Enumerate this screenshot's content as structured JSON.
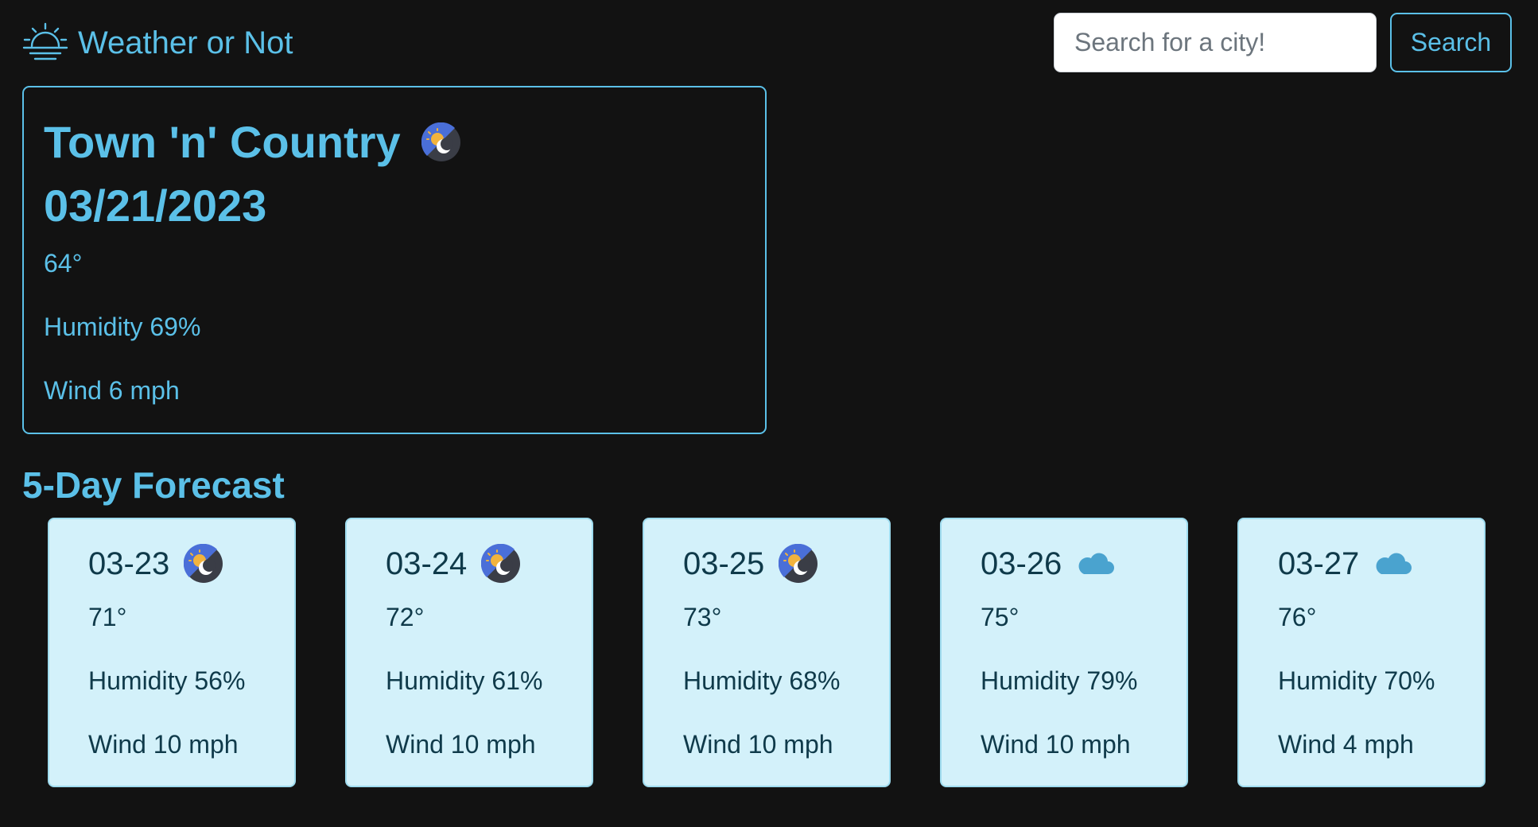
{
  "app": {
    "title": "Weather or Not",
    "accent_color": "#5bc0e8",
    "background_color": "#121212",
    "brand_icon": "sunrise-icon"
  },
  "search": {
    "placeholder": "Search for a city!",
    "value": "",
    "button_label": "Search"
  },
  "current": {
    "city": "Town 'n' Country",
    "date": "03/21/2023",
    "icon": "partly-cloudy-night-icon",
    "temp": "64°",
    "humidity": "Humidity 69%",
    "wind": "Wind 6 mph"
  },
  "forecast": {
    "heading": "5-Day Forecast",
    "card_color": "#d3f1fa",
    "days": [
      {
        "date": "03-23",
        "icon": "partly-cloudy-night-icon",
        "temp": "71°",
        "humidity": "Humidity 56%",
        "wind": "Wind 10 mph"
      },
      {
        "date": "03-24",
        "icon": "partly-cloudy-night-icon",
        "temp": "72°",
        "humidity": "Humidity 61%",
        "wind": "Wind 10 mph"
      },
      {
        "date": "03-25",
        "icon": "partly-cloudy-night-icon",
        "temp": "73°",
        "humidity": "Humidity 68%",
        "wind": "Wind 10 mph"
      },
      {
        "date": "03-26",
        "icon": "cloud-icon",
        "temp": "75°",
        "humidity": "Humidity 79%",
        "wind": "Wind 10 mph"
      },
      {
        "date": "03-27",
        "icon": "cloud-icon",
        "temp": "76°",
        "humidity": "Humidity 70%",
        "wind": "Wind 4 mph"
      }
    ]
  }
}
